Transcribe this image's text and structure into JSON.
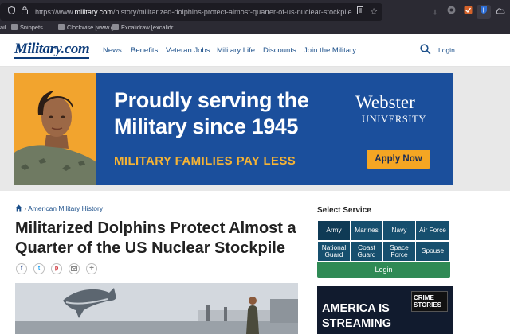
{
  "browser": {
    "url_prefix": "https://www.",
    "url_domain": "military.com",
    "url_path": "/history/militarized-dolphins-protect-almost-quarter-of-us-nuclear-stockpile.html",
    "bookmarks": [
      {
        "label": "ail"
      },
      {
        "label": "Snippets"
      },
      {
        "label": "Clockwise [www.ge..."
      },
      {
        "label": "Excalidraw [excalidr..."
      }
    ]
  },
  "header": {
    "logo": "Military.com",
    "nav": [
      "News",
      "Benefits",
      "Veteran Jobs",
      "Military Life",
      "Discounts",
      "Join the Military"
    ],
    "login": "Login",
    "brand_color": "#0d3c7a"
  },
  "ad": {
    "headline_line1": "Proudly serving the",
    "headline_line2": "Military since 1945",
    "subline": "MILITARY FAMILIES PAY LESS",
    "brand_line1": "Webster",
    "brand_line2": "UNIVERSITY",
    "button": "Apply Now",
    "bg_color": "#1b4f9c",
    "accent_color": "#f5a623"
  },
  "article": {
    "breadcrumb": "American Military History",
    "title": "Militarized Dolphins Protect Almost a Quarter of the US Nuclear Stockpile",
    "share_icons": [
      "facebook-icon",
      "twitter-icon",
      "pinterest-icon",
      "email-icon",
      "more-icon"
    ]
  },
  "sidebar": {
    "title": "Select Service",
    "services": [
      "Army",
      "Marines",
      "Navy",
      "Air Force",
      "National Guard",
      "Coast Guard",
      "Space Force",
      "Spouse"
    ],
    "login": "Login",
    "ad_line1": "AMERICA IS",
    "ad_line2": "STREAMING",
    "ad_tag": "CRIME STORIES"
  }
}
